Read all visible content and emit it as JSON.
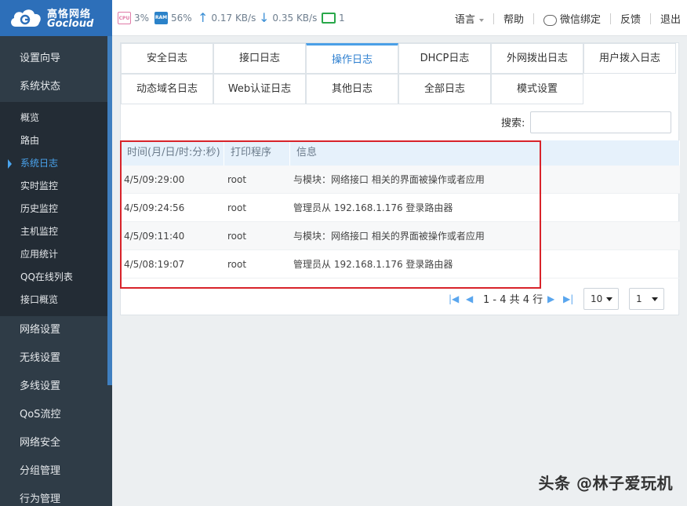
{
  "brand": {
    "name_cn": "高恪网络",
    "name_en": "Gocloud",
    "color": "#2d6fb9"
  },
  "status": {
    "cpu_label": "CPU",
    "cpu": "3%",
    "ram_label": "RAM",
    "ram": "56%",
    "upload": "0.17 KB/s",
    "download": "0.35 KB/s",
    "devices": "1"
  },
  "top_links": {
    "language": "语言",
    "help": "帮助",
    "wechat": "微信绑定",
    "feedback": "反馈",
    "logout": "退出"
  },
  "sidebar": {
    "top_items": [
      "设置向导",
      "系统状态"
    ],
    "sub_items": [
      "概览",
      "路由",
      "系统日志",
      "实时监控",
      "历史监控",
      "主机监控",
      "应用统计",
      "QQ在线列表",
      "接口概览"
    ],
    "active_sub": "系统日志",
    "bottom_items": [
      "网络设置",
      "无线设置",
      "多线设置",
      "QoS流控",
      "网络安全",
      "分组管理",
      "行为管理"
    ]
  },
  "tabs": {
    "row1": [
      "安全日志",
      "接口日志",
      "操作日志",
      "DHCP日志",
      "外网拨出日志",
      "用户拨入日志"
    ],
    "row2": [
      "动态域名日志",
      "Web认证日志",
      "其他日志",
      "全部日志",
      "模式设置"
    ],
    "active": "操作日志"
  },
  "search": {
    "label": "搜索:",
    "placeholder": ""
  },
  "table": {
    "headers": [
      "时间(月/日/时:分:秒)",
      "打印程序",
      "信息"
    ],
    "rows": [
      [
        "4/5/09:29:00",
        "root",
        "与模块：网络接口 相关的界面被操作或者应用"
      ],
      [
        "4/5/09:24:56",
        "root",
        "管理员从 192.168.1.176 登录路由器"
      ],
      [
        "4/5/09:11:40",
        "root",
        "与模块：网络接口 相关的界面被操作或者应用"
      ],
      [
        "4/5/08:19:07",
        "root",
        "管理员从 192.168.1.176 登录路由器"
      ]
    ]
  },
  "pager": {
    "info": "1 - 4 共 4 行",
    "page_size": "10",
    "page": "1"
  },
  "watermark": "头条 @林子爱玩机"
}
